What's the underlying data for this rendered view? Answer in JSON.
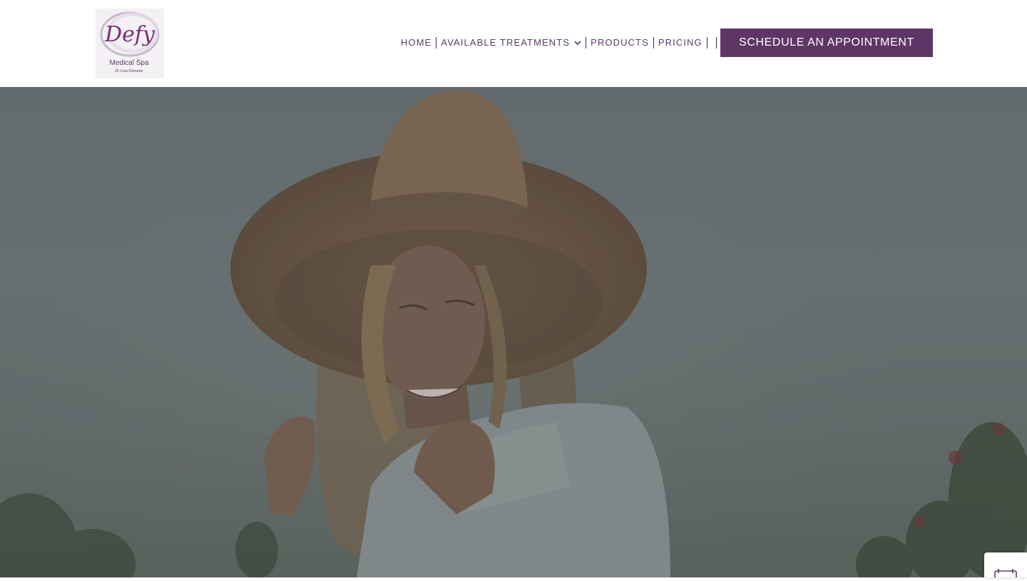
{
  "logo": {
    "script_text": "Defy",
    "line1": "Medical Spa",
    "line2": "Dr Lisa Gieseke"
  },
  "nav": {
    "items": [
      {
        "label": "HOME"
      },
      {
        "label": "AVAILABLE TREATMENTS",
        "has_dropdown": true
      },
      {
        "label": "PRODUCTS"
      },
      {
        "label": "PRICING"
      }
    ]
  },
  "cta": {
    "label": "SCHEDULE AN APPOINTMENT"
  },
  "hero": {
    "image": "woman-in-straw-hat-video"
  },
  "widget": {
    "icon": "calendar-icon"
  },
  "colors": {
    "brand_purple": "#5e3666",
    "nav_text": "#5a3b64"
  }
}
